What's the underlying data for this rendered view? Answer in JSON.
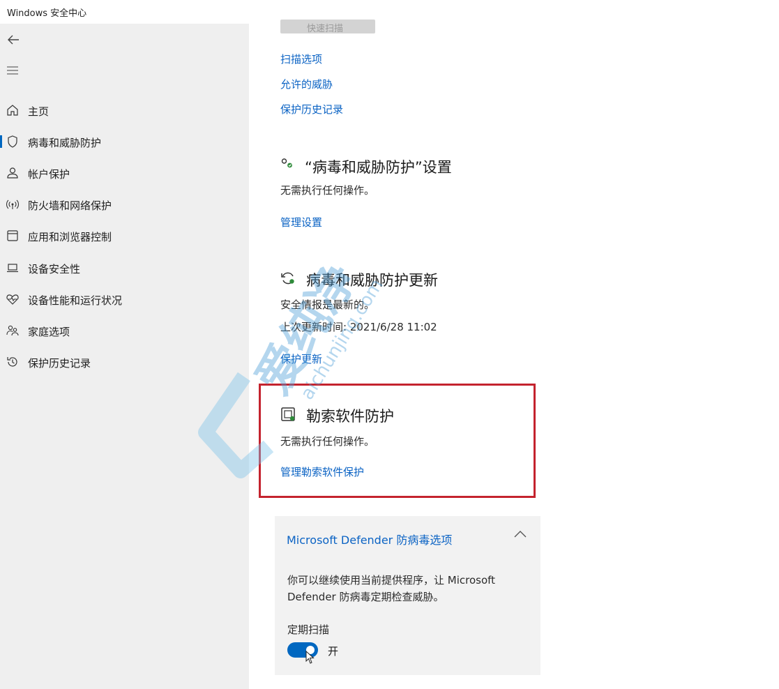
{
  "window": {
    "title": "Windows 安全中心"
  },
  "sidebar": {
    "items": [
      {
        "label": "主页",
        "icon": "home-icon"
      },
      {
        "label": "病毒和威胁防护",
        "icon": "shield-icon",
        "selected": true
      },
      {
        "label": "帐户保护",
        "icon": "person-icon"
      },
      {
        "label": "防火墙和网络保护",
        "icon": "wifi-signal-icon"
      },
      {
        "label": "应用和浏览器控制",
        "icon": "app-window-icon"
      },
      {
        "label": "设备安全性",
        "icon": "laptop-icon"
      },
      {
        "label": "设备性能和运行状况",
        "icon": "heart-pulse-icon"
      },
      {
        "label": "家庭选项",
        "icon": "family-icon"
      },
      {
        "label": "保护历史记录",
        "icon": "history-icon"
      }
    ]
  },
  "main": {
    "scan_button_label": "快速扫描",
    "links_top": [
      "扫描选项",
      "允许的威胁",
      "保护历史记录"
    ],
    "settings_section": {
      "title": "“病毒和威胁防护”设置",
      "status": "无需执行任何操作。",
      "link": "管理设置",
      "icon": "settings-gear-icon"
    },
    "updates_section": {
      "title": "病毒和威胁防护更新",
      "status": "安全情报是最新的。",
      "last_update": "上次更新时间: 2021/6/28 11:02",
      "link": "保护更新",
      "icon": "refresh-icon"
    },
    "ransomware_section": {
      "title": "勒索软件防护",
      "status": "无需执行任何操作。",
      "link": "管理勒索软件保护",
      "icon": "ransomware-folder-icon"
    },
    "defender_card": {
      "title": "Microsoft Defender 防病毒选项",
      "description": "你可以继续使用当前提供程序，让 Microsoft Defender 防病毒定期检查威胁。",
      "periodic_scan_label": "定期扫描",
      "toggle_state": "开",
      "toggle_on": true
    }
  },
  "watermark": {
    "text": "爱纯净",
    "url_text": "aichunjing.com"
  },
  "colors": {
    "accent": "#0067c0",
    "link": "#0b63c4",
    "highlight_box": "#c4232e",
    "sidebar_bg": "#efefef"
  }
}
